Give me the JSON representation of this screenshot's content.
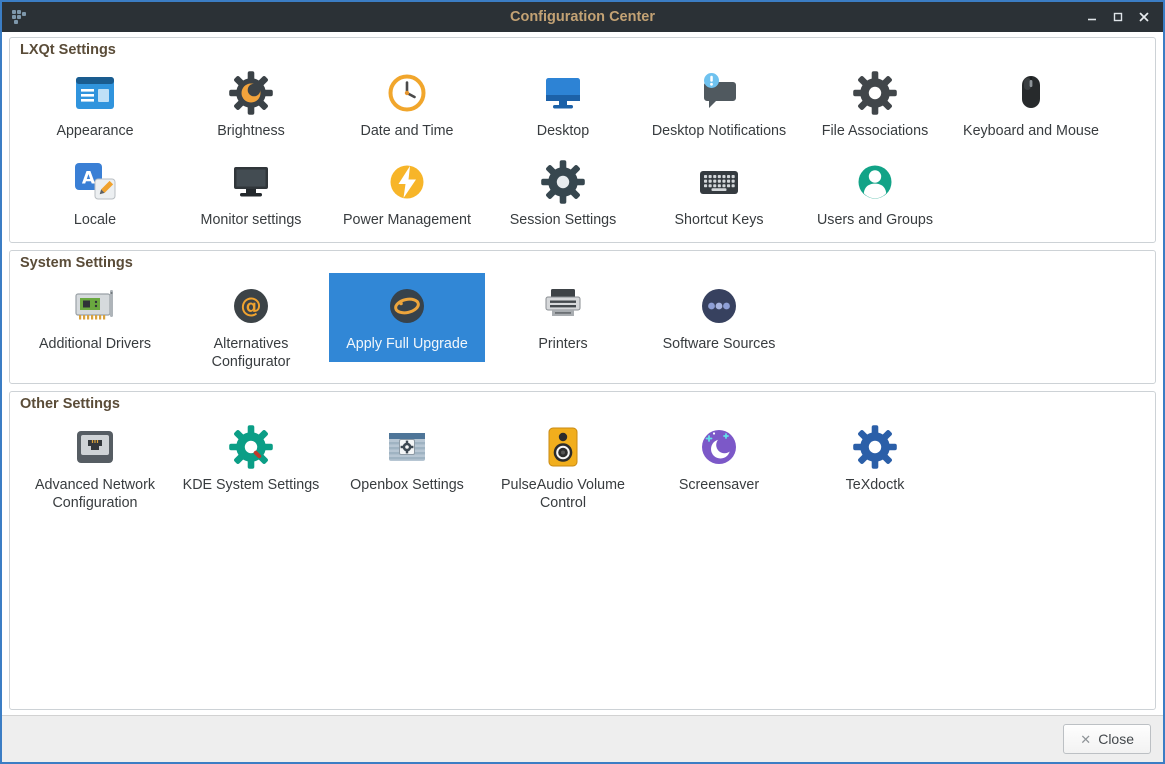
{
  "window": {
    "title": "Configuration Center",
    "app_icon": "lxqt-config-app-icon",
    "controls": {
      "minimize_icon": "minimize-icon",
      "maximize_icon": "maximize-icon",
      "close_icon": "close-icon"
    }
  },
  "sections": [
    {
      "title": "LXQt Settings",
      "items": [
        {
          "label": "Appearance",
          "icon": "appearance-icon"
        },
        {
          "label": "Brightness",
          "icon": "brightness-icon"
        },
        {
          "label": "Date and Time",
          "icon": "datetime-icon"
        },
        {
          "label": "Desktop",
          "icon": "desktop-icon"
        },
        {
          "label": "Desktop Notifications",
          "icon": "desktop-notifications-icon"
        },
        {
          "label": "File Associations",
          "icon": "file-associations-icon"
        },
        {
          "label": "Keyboard and Mouse",
          "icon": "keyboard-mouse-icon"
        },
        {
          "label": "Locale",
          "icon": "locale-icon"
        },
        {
          "label": "Monitor settings",
          "icon": "monitor-settings-icon"
        },
        {
          "label": "Power Management",
          "icon": "power-management-icon"
        },
        {
          "label": "Session Settings",
          "icon": "session-settings-icon"
        },
        {
          "label": "Shortcut Keys",
          "icon": "shortcut-keys-icon"
        },
        {
          "label": "Users and Groups",
          "icon": "users-groups-icon"
        }
      ]
    },
    {
      "title": "System Settings",
      "items": [
        {
          "label": "Additional Drivers",
          "icon": "additional-drivers-icon"
        },
        {
          "label": "Alternatives Configurator",
          "icon": "alternatives-configurator-icon"
        },
        {
          "label": "Apply Full Upgrade",
          "icon": "apply-full-upgrade-icon",
          "selected": true
        },
        {
          "label": "Printers",
          "icon": "printers-icon"
        },
        {
          "label": "Software Sources",
          "icon": "software-sources-icon"
        }
      ]
    },
    {
      "title": "Other Settings",
      "items": [
        {
          "label": "Advanced Network Configuration",
          "icon": "advanced-network-icon"
        },
        {
          "label": "KDE System Settings",
          "icon": "kde-system-settings-icon"
        },
        {
          "label": "Openbox Settings",
          "icon": "openbox-settings-icon"
        },
        {
          "label": "PulseAudio Volume Control",
          "icon": "pulseaudio-icon"
        },
        {
          "label": "Screensaver",
          "icon": "screensaver-icon"
        },
        {
          "label": "TeXdoctk",
          "icon": "texdoctk-icon"
        }
      ]
    }
  ],
  "footer": {
    "close_label": "Close",
    "close_icon": "✕"
  },
  "colors": {
    "selection": "#3187d6",
    "titlebar": "#2b3136",
    "title_text": "#c3a274",
    "section_title": "#5a4c38",
    "window_border": "#3b7dc4"
  }
}
